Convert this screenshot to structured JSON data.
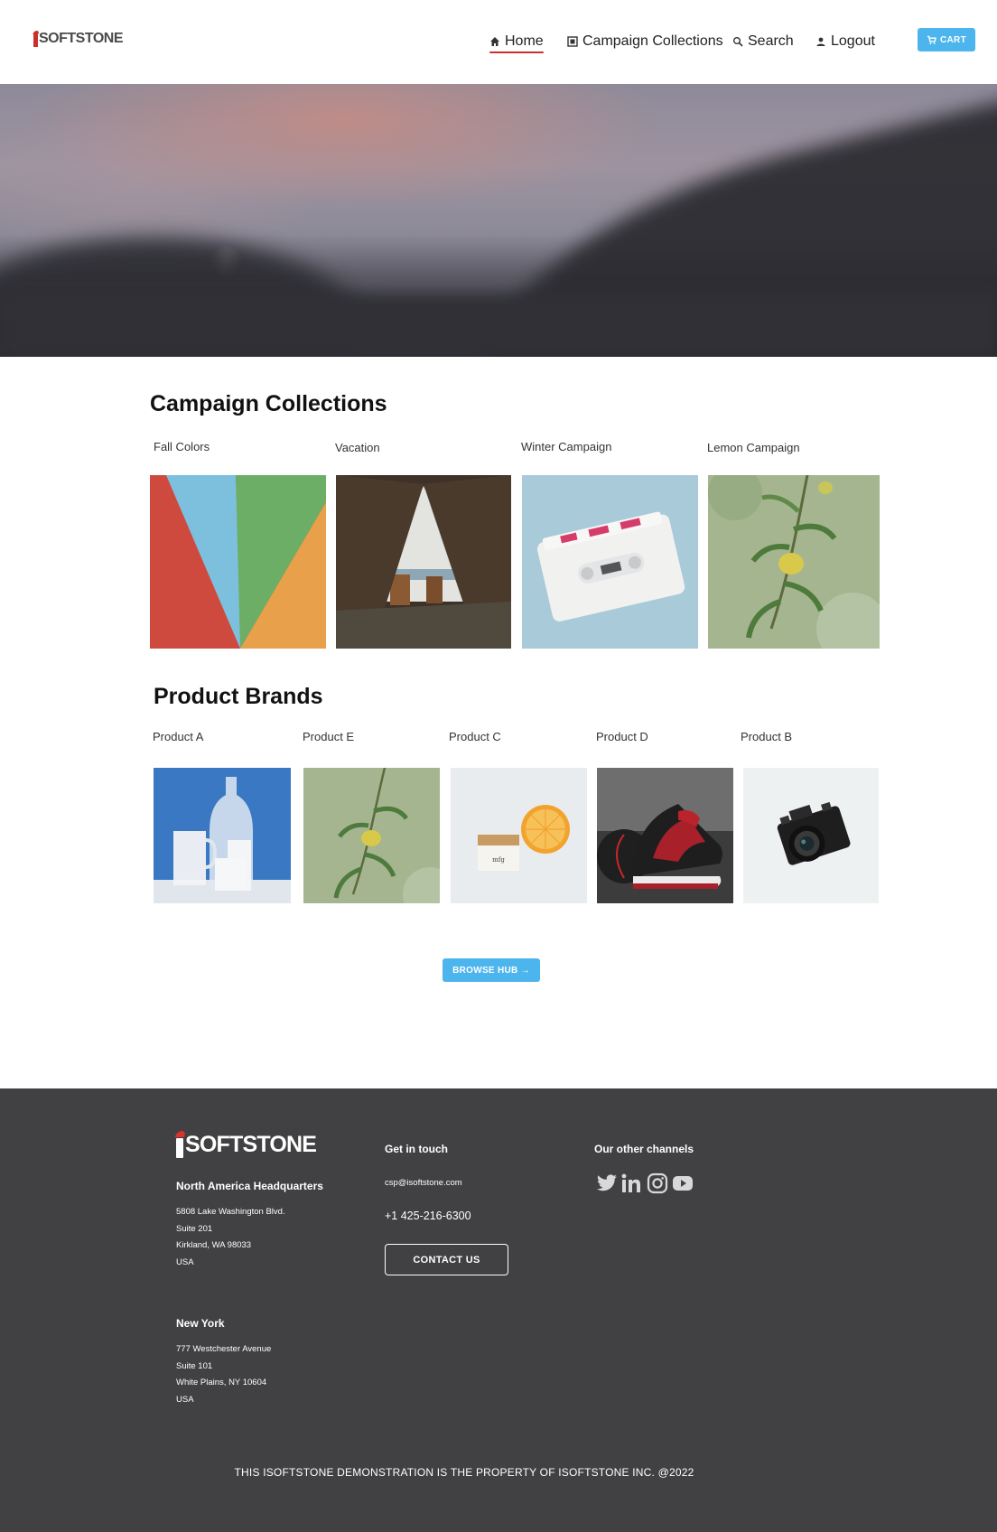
{
  "header": {
    "logo_text": "SOFTSTONE",
    "logo_alt": "iSoftStone",
    "nav": [
      {
        "label": "Home",
        "icon": "home-icon",
        "active": true
      },
      {
        "label": "Campaign Collections",
        "icon": "collections-icon",
        "active": false
      },
      {
        "label": "Search",
        "icon": "search-icon",
        "active": false
      },
      {
        "label": "Logout",
        "icon": "person-icon",
        "active": false
      }
    ],
    "cart_label": "CART"
  },
  "campaigns": {
    "title": "Campaign Collections",
    "items": [
      {
        "label": "Fall Colors"
      },
      {
        "label": "Vacation"
      },
      {
        "label": "Winter Campaign"
      },
      {
        "label": "Lemon Campaign"
      }
    ]
  },
  "brands": {
    "title": "Product Brands",
    "items": [
      {
        "label": "Product A"
      },
      {
        "label": "Product E"
      },
      {
        "label": "Product C"
      },
      {
        "label": "Product D"
      },
      {
        "label": "Product B"
      }
    ]
  },
  "browse_label": "BROWSE HUB →",
  "footer": {
    "logo_text": "SOFTSTONE",
    "hq_title": "North America Headquarters",
    "hq_lines": [
      "5808 Lake Washington Blvd.",
      "Suite 201",
      "Kirkland, WA 98033",
      "USA"
    ],
    "ny_title": "New York",
    "ny_lines": [
      "777 Westchester Avenue",
      "Suite 101",
      "White Plains, NY 10604",
      "USA"
    ],
    "contact_title": "Get in touch",
    "email": "csp@isoftstone.com",
    "phone": "+1 425-216-6300",
    "contact_button": "CONTACT US",
    "channels_title": "Our other channels",
    "channels": [
      "twitter-icon",
      "linkedin-icon",
      "instagram-icon",
      "youtube-icon"
    ],
    "copyright": "THIS ISOFTSTONE DEMONSTRATION IS THE PROPERTY OF ISOFTSTONE INC. @2022"
  },
  "colors": {
    "accent": "#4db5ee",
    "underline": "#c9302c",
    "footer_bg": "#414042"
  }
}
